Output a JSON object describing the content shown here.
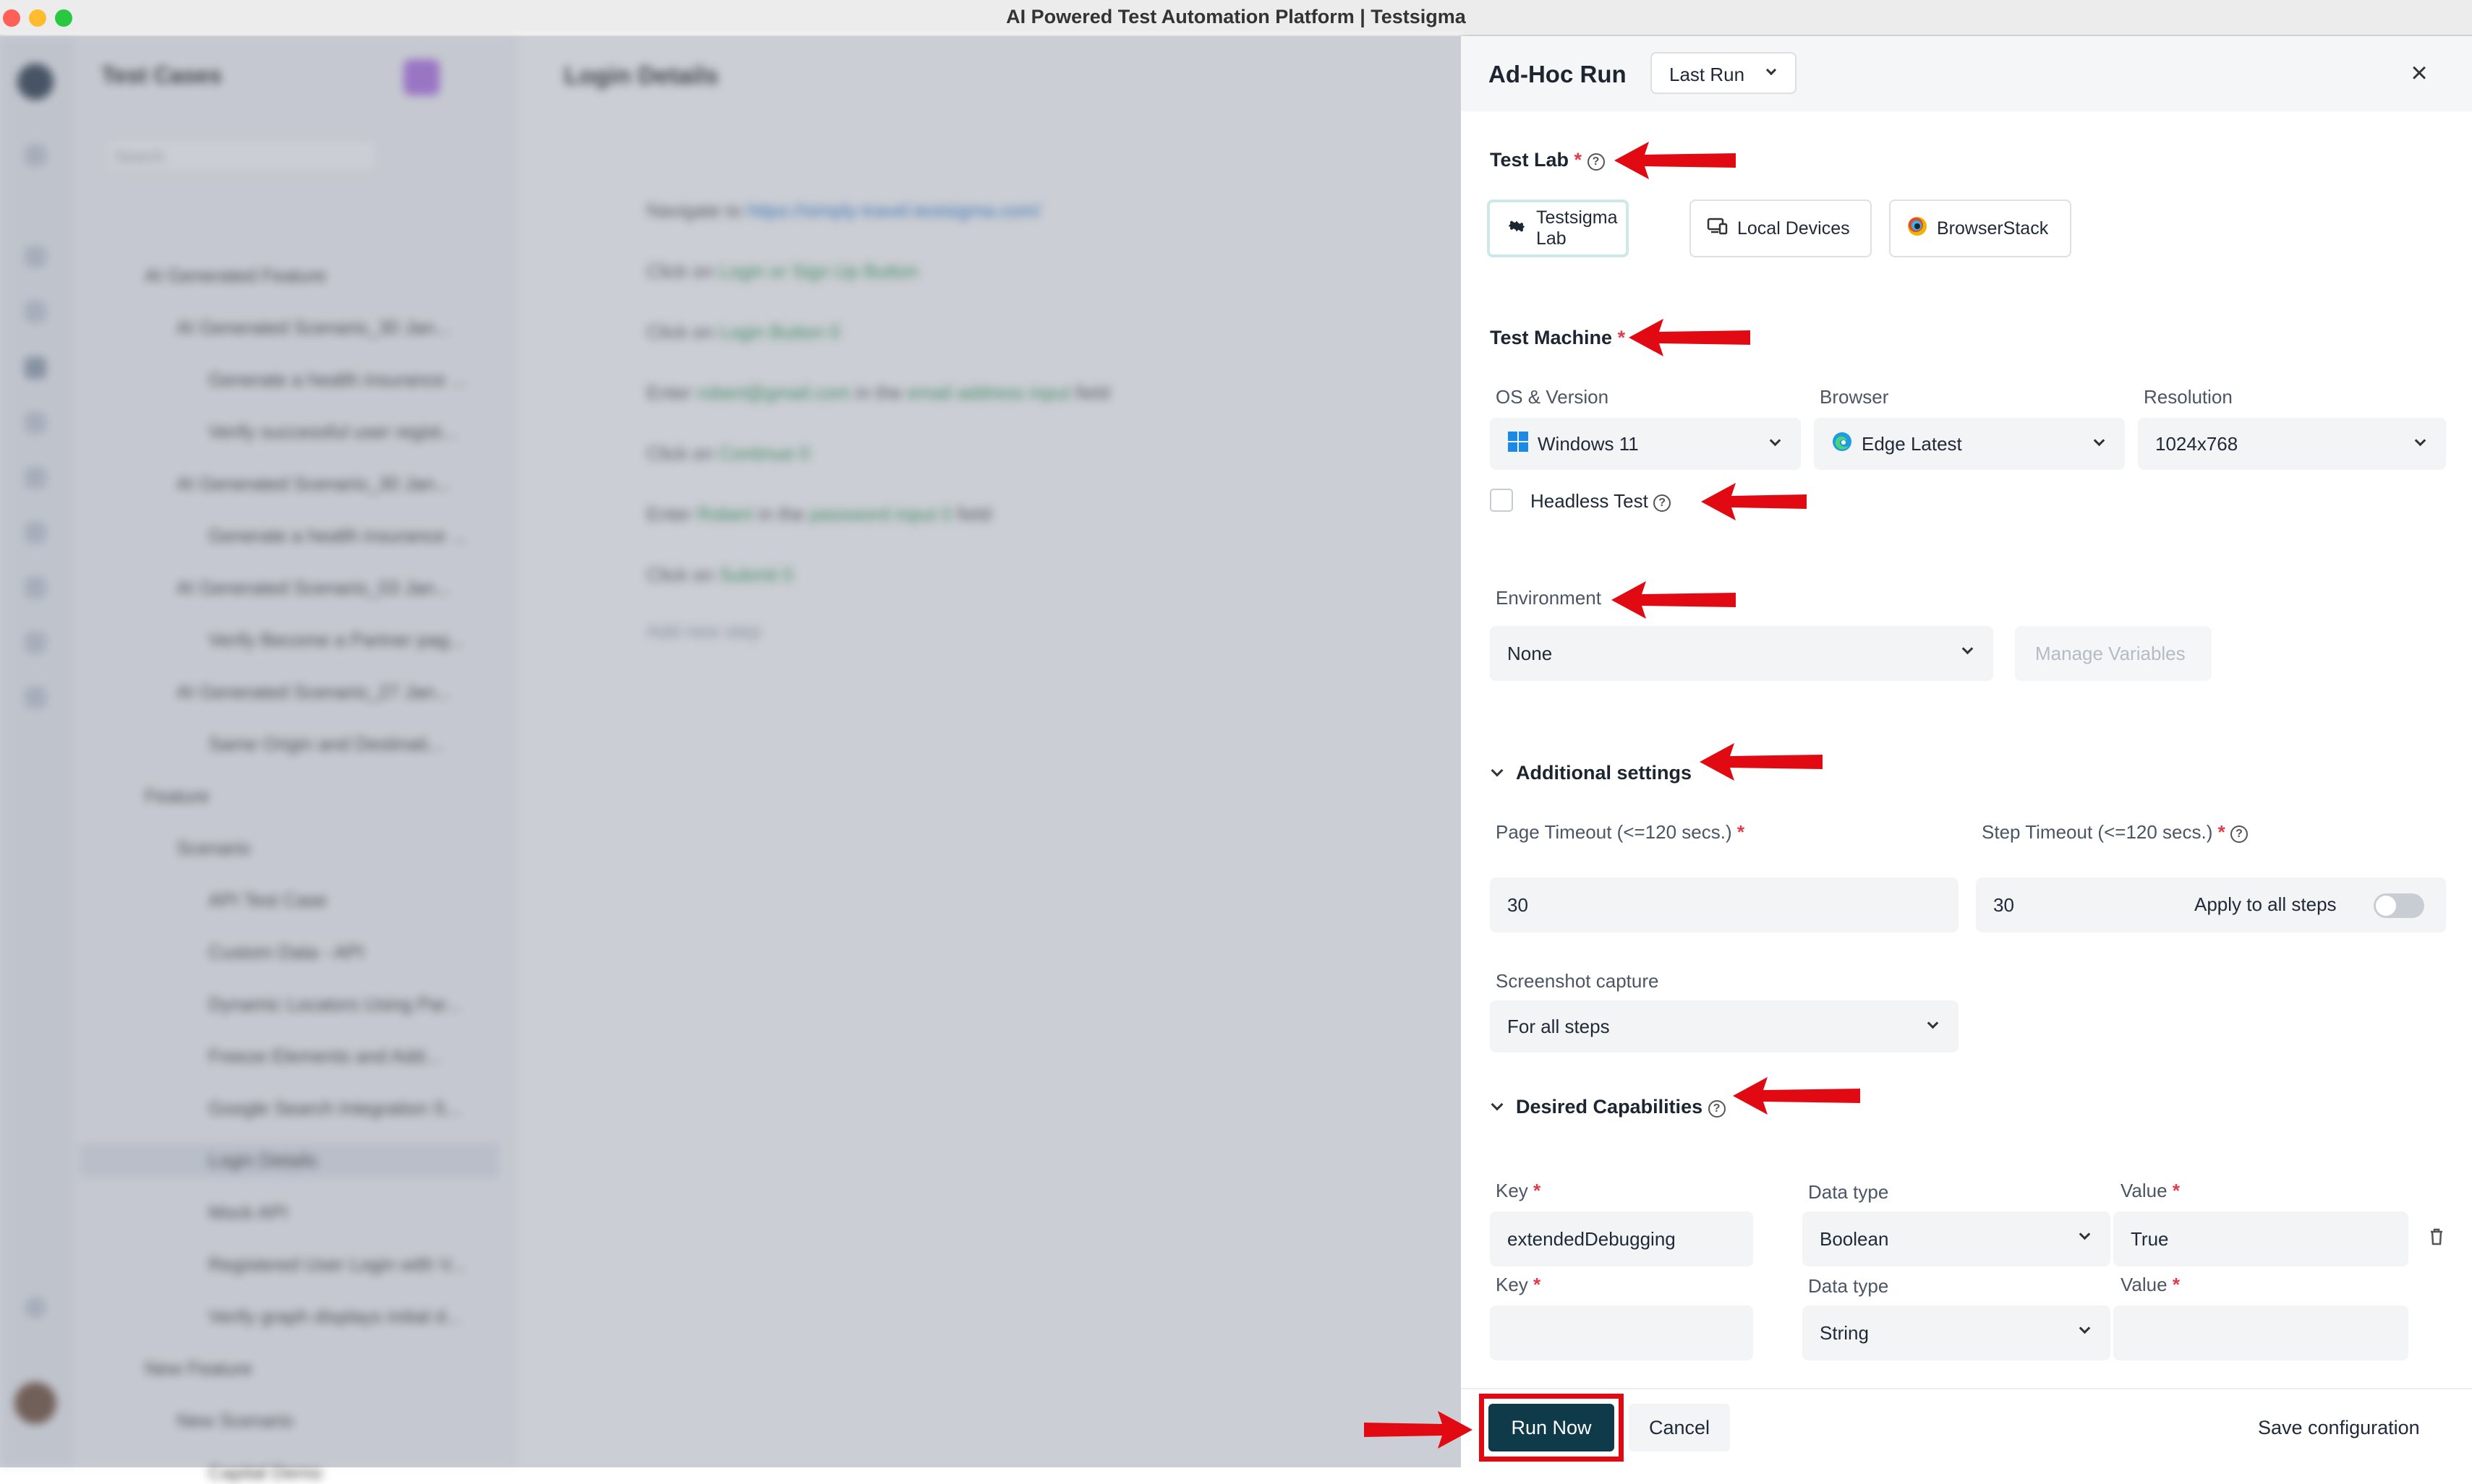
{
  "window": {
    "title": "AI Powered Test Automation Platform | Testsigma"
  },
  "background": {
    "tree_title": "Test Cases",
    "search_placeholder": "Search",
    "tree_items": [
      "AI Generated Feature",
      "AI Generated Scenario_30 Jan...",
      "Generate a health insurance ...",
      "Verify successful user regist...",
      "AI Generated Scenario_30 Jan...",
      "Generate a health insurance ...",
      "AI Generated Scenario_03 Jan...",
      "Verify Become a Partner pag...",
      "AI Generated Scenario_27 Jan...",
      "Same Origin and Destinati...",
      "Feature",
      "Scenario",
      "API Test Case",
      "Custom Data - API",
      "Dynamic Locators Using Par...",
      "Freeze Elements and Add...",
      "Google Search Integration S...",
      "Login Details",
      "Mock API",
      "Registered User Login with V...",
      "Verify graph displays initial d...",
      "New Feature",
      "New Scenario",
      "Capital Demo"
    ],
    "detail_title": "Login Details",
    "steps": [
      {
        "pre": "Navigate to",
        "link": "https://simply-travel.testsigma.com/",
        "post": ""
      },
      {
        "pre": "Click on",
        "link": "Login or Sign Up Button",
        "post": ""
      },
      {
        "pre": "Click on",
        "link": "Login Button 0",
        "post": ""
      },
      {
        "pre": "Enter",
        "link": "robert@gmail.com",
        "mid": "in the",
        "link2": "email address input",
        "post": "field"
      },
      {
        "pre": "Click on",
        "link": "Continue 0",
        "post": ""
      },
      {
        "pre": "Enter",
        "link": "Robert",
        "mid": "in the",
        "link2": "password input 0",
        "post": "field"
      },
      {
        "pre": "Click on",
        "link": "Submit 0",
        "post": ""
      }
    ],
    "add_step": "Add new step"
  },
  "panel": {
    "title": "Ad-Hoc Run",
    "run_select": "Last Run",
    "test_lab": {
      "label": "Test Lab",
      "options": [
        "Testsigma Lab",
        "Local Devices",
        "BrowserStack"
      ],
      "selected": "Testsigma Lab"
    },
    "test_machine": {
      "label": "Test Machine",
      "os_label": "OS & Version",
      "os_value": "Windows 11",
      "browser_label": "Browser",
      "browser_value": "Edge Latest",
      "resolution_label": "Resolution",
      "resolution_value": "1024x768",
      "headless_label": "Headless Test",
      "headless_checked": false
    },
    "environment": {
      "label": "Environment",
      "value": "None",
      "manage_label": "Manage Variables"
    },
    "additional": {
      "label": "Additional settings",
      "page_timeout_label": "Page Timeout (<=120 secs.)",
      "page_timeout_value": "30",
      "step_timeout_label": "Step Timeout (<=120 secs.)",
      "step_timeout_value": "30",
      "apply_all_label": "Apply to all steps",
      "apply_all_on": false,
      "screenshot_label": "Screenshot capture",
      "screenshot_value": "For all steps"
    },
    "capabilities": {
      "label": "Desired Capabilities",
      "key_label": "Key",
      "type_label": "Data type",
      "value_label": "Value",
      "rows": [
        {
          "key": "extendedDebugging",
          "type": "Boolean",
          "value": "True"
        },
        {
          "key": "",
          "type": "String",
          "value": ""
        }
      ]
    },
    "footer": {
      "run": "Run Now",
      "cancel": "Cancel",
      "save": "Save configuration"
    }
  },
  "colors": {
    "primary": "#0e3a4a",
    "required": "#e5394a",
    "annotation": "#e10a12",
    "field_bg": "#f3f4f6"
  }
}
